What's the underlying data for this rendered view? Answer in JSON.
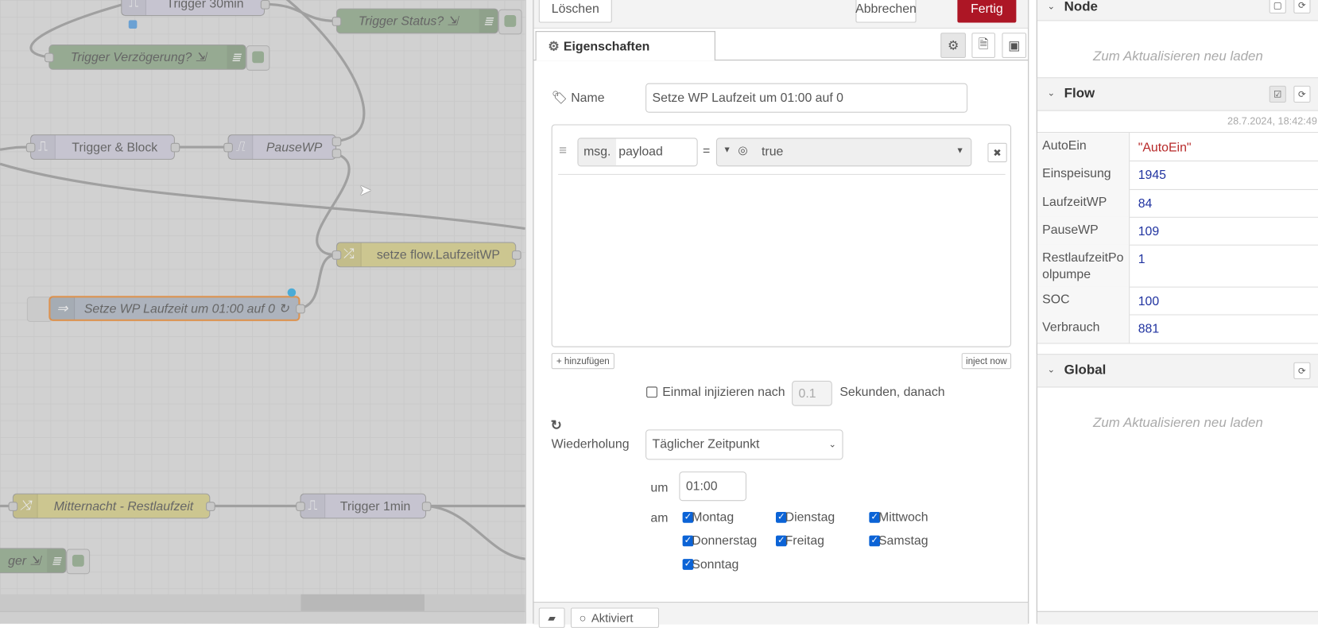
{
  "canvas": {
    "nodes": [
      {
        "label": "Trigger 30min",
        "type": "trigger"
      },
      {
        "label": "Trigger Status? ⇲",
        "type": "debug"
      },
      {
        "label": "Trigger Verzögerung? ⇲",
        "type": "debug"
      },
      {
        "label": "Trigger & Block",
        "type": "trigger"
      },
      {
        "label": "PauseWP",
        "type": "trigger"
      },
      {
        "label": "setze flow.LaufzeitWP",
        "type": "change"
      },
      {
        "label": "Setze WP Laufzeit um 01:00 auf 0 ↻",
        "type": "inject",
        "selected": true
      },
      {
        "label": "Mitternacht - Restlaufzeit",
        "type": "switch"
      },
      {
        "label": "Trigger 1min",
        "type": "trigger"
      },
      {
        "label": "ger ⇲",
        "type": "debug"
      }
    ]
  },
  "tray": {
    "delete_label": "Löschen",
    "cancel_label": "Abbrechen",
    "done_label": "Fertig",
    "tab_label": "Eigenschaften",
    "name_label": "Name",
    "name_value": "Setze WP Laufzeit um 01:00 auf 0",
    "rule": {
      "prefix": "msg.",
      "property": "payload",
      "operator": "=",
      "value": "true"
    },
    "add_label": "hinzufügen",
    "inject_now_label": "inject now",
    "once_label": "Einmal injizieren nach",
    "once_checked": false,
    "once_delay": "0.1",
    "once_suffix": "Sekunden, danach",
    "repeat_label": "Wiederholung",
    "repeat_value": "Täglicher Zeitpunkt",
    "at_label": "um",
    "at_value": "01:00",
    "on_label": "am",
    "days": [
      {
        "label": "Montag",
        "checked": true
      },
      {
        "label": "Dienstag",
        "checked": true
      },
      {
        "label": "Mittwoch",
        "checked": true
      },
      {
        "label": "Donnerstag",
        "checked": true
      },
      {
        "label": "Freitag",
        "checked": true
      },
      {
        "label": "Samstag",
        "checked": true
      },
      {
        "label": "Sonntag",
        "checked": true
      }
    ],
    "footer_status": "Aktiviert",
    "accent": "#ad1625"
  },
  "sidebar": {
    "node": {
      "title": "Node",
      "empty": "Zum Aktualisieren neu laden"
    },
    "flow": {
      "title": "Flow",
      "timestamp": "28.7.2024, 18:42:49",
      "rows": [
        {
          "key": "AutoEin",
          "value": "\"AutoEin\"",
          "kind": "string"
        },
        {
          "key": "Einspeisung",
          "value": "1945",
          "kind": "number"
        },
        {
          "key": "LaufzeitWP",
          "value": "84",
          "kind": "number"
        },
        {
          "key": "PauseWP",
          "value": "109",
          "kind": "number"
        },
        {
          "key": "RestlaufzeitPoolpumpe",
          "value": "1",
          "kind": "number"
        },
        {
          "key": "SOC",
          "value": "100",
          "kind": "number"
        },
        {
          "key": "Verbrauch",
          "value": "881",
          "kind": "number"
        }
      ]
    },
    "global": {
      "title": "Global",
      "empty": "Zum Aktualisieren neu laden"
    }
  }
}
